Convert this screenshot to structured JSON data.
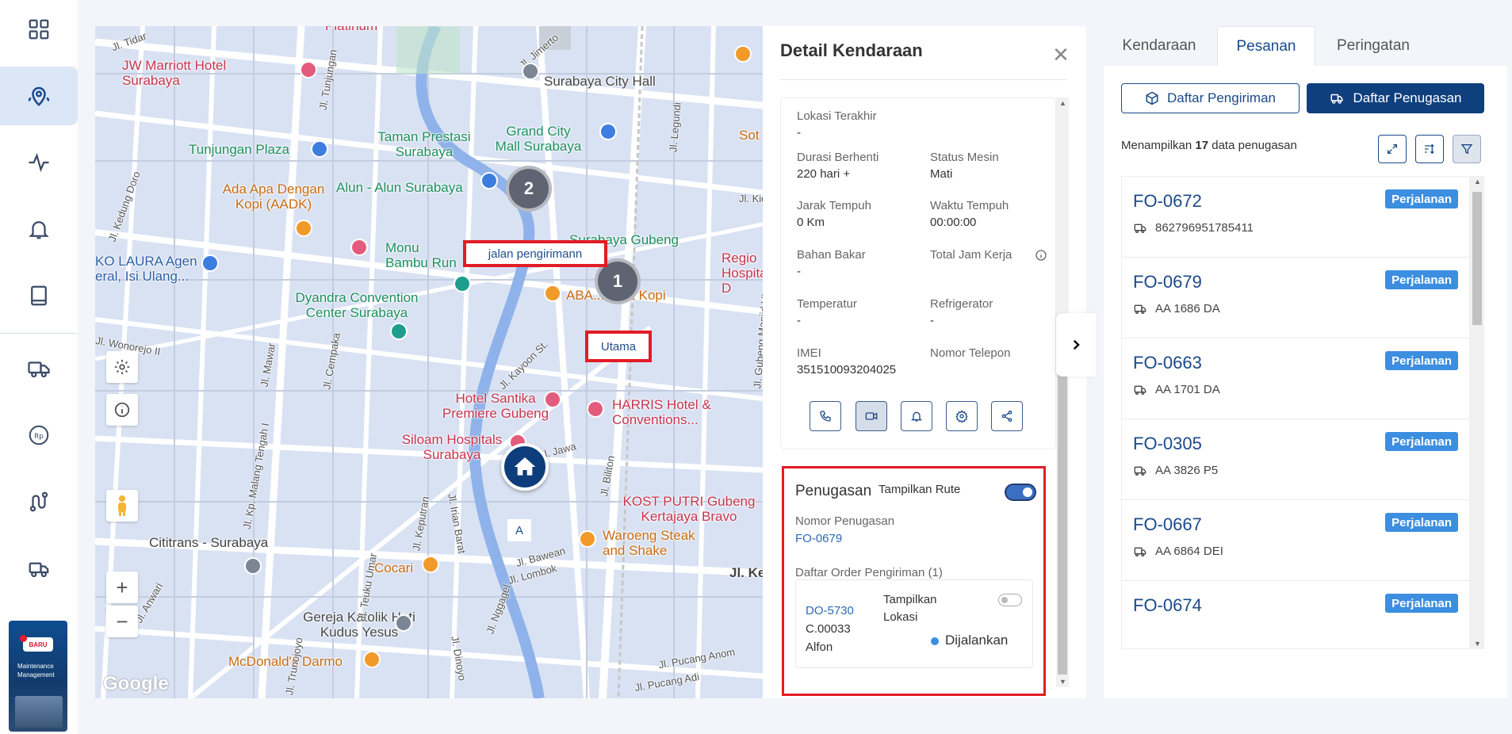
{
  "sidebar": {
    "items": [
      {
        "name": "dashboard",
        "icon": "grid-icon"
      },
      {
        "name": "tracking",
        "icon": "location-pin-icon",
        "active": true
      },
      {
        "name": "activity",
        "icon": "pulse-icon"
      },
      {
        "name": "notifications",
        "icon": "bell-icon"
      },
      {
        "name": "reports",
        "icon": "book-icon"
      },
      {
        "name": "vehicles",
        "icon": "truck-icon"
      },
      {
        "name": "finance",
        "icon": "rupiah-icon"
      },
      {
        "name": "routes",
        "icon": "route-icon"
      },
      {
        "name": "delivery",
        "icon": "delivery-truck-icon"
      }
    ],
    "promo": {
      "badge": "BARU",
      "text": "Maintenance Management"
    }
  },
  "map": {
    "labels": [
      "Platinum",
      "JW Marriott Hotel Surabaya",
      "Jl. Tidar",
      "Jl. Tunjungan",
      "Jl. Jimerto",
      "Surabaya City Hall",
      "Taman Prestasi Surabaya",
      "Grand City Mall Surabaya",
      "Tunjungan Plaza",
      "Alun - Alun Surabaya",
      "Ada Apa Dengan Kopi (AADK)",
      "Monu Bambu Run",
      "Surabaya Gubeng",
      "KO LAURA Agen eral, Isi Ulang...",
      "Dyandra Convention Center Surabaya",
      "ABA... mi & Kopi",
      "Regio Hospital D",
      "Hotel Santika Premiere Gubeng",
      "HARRIS Hotel & Conventions...",
      "Siloam Hospitals Surabaya",
      "Jl. Jawa",
      "Jl. Biliton",
      "KOST PUTRI Gubeng Kertajaya Bravo",
      "Cititrans - Surabaya",
      "Waroeng Steak and Shake",
      "Cocari",
      "Jl. Bawean",
      "Jl. Lombok",
      "Jl. Nggagel",
      "Gereja Katolik Hati Kudus Yesus",
      "McDonald's Darmo",
      "Jl. Kedung Doro",
      "Jl. Pucang Adi",
      "Jl. Pucang Anom",
      "Sot",
      "Jl. Legundi",
      "Jl. Kidal",
      "Jl. Gubeng Masjid VI",
      "Jl. Kayoon St.",
      "Jl. Wonorejo II",
      "Jl. Mawar",
      "Jl. Cempaka",
      "Jl. Kp. Malang Tengah I",
      "Jl. Keputran",
      "Jl. Irian Barat",
      "Jl. Teuku Umar",
      "Jl. Dinoyo",
      "Jl. Anwari",
      "Jl. Trunojoyo",
      "Jl. Ke"
    ],
    "clusters": [
      "2",
      "1"
    ],
    "tags": {
      "route": "jalan pengirimann",
      "main": "Utama",
      "point": "A"
    },
    "zoom_in": "+",
    "zoom_out": "−"
  },
  "detail": {
    "title": "Detail Kendaraan",
    "fields": {
      "lokasi_label": "Lokasi Terakhir",
      "lokasi": "-",
      "durasi_label": "Durasi Berhenti",
      "durasi": "220 hari +",
      "mesin_label": "Status Mesin",
      "mesin": "Mati",
      "jarak_label": "Jarak Tempuh",
      "jarak": "0 Km",
      "waktu_label": "Waktu Tempuh",
      "waktu": "00:00:00",
      "bbm_label": "Bahan Bakar",
      "bbm": "-",
      "jam_label": "Total Jam Kerja",
      "temp_label": "Temperatur",
      "temp": "-",
      "fridge_label": "Refrigerator",
      "fridge": "-",
      "imei_label": "IMEI",
      "imei": "351510093204025",
      "telp_label": "Nomor Telepon"
    },
    "assignment": {
      "title": "Penugasan",
      "route_toggle": "Tampilkan Rute",
      "nomor_label": "Nomor Penugasan",
      "nomor": "FO-0679",
      "orders_label": "Daftar Order Pengiriman (1)",
      "order": {
        "code": "DO-5730",
        "customer_code": "C.00033",
        "customer": "Alfon",
        "location_toggle": "Tampilkan Lokasi",
        "status": "Dijalankan"
      }
    }
  },
  "right": {
    "tabs": [
      "Kendaraan",
      "Pesanan",
      "Peringatan"
    ],
    "btn_pengiriman": "Daftar Pengiriman",
    "btn_penugasan": "Daftar Penugasan",
    "count_prefix": "Menampilkan",
    "count": "17",
    "count_suffix": "data penugasan",
    "rows": [
      {
        "code": "FO-0672",
        "plate": "862796951785411",
        "status": "Perjalanan"
      },
      {
        "code": "FO-0679",
        "plate": "AA 1686 DA",
        "status": "Perjalanan"
      },
      {
        "code": "FO-0663",
        "plate": "AA 1701 DA",
        "status": "Perjalanan"
      },
      {
        "code": "FO-0305",
        "plate": "AA 3826 P5",
        "status": "Perjalanan"
      },
      {
        "code": "FO-0667",
        "plate": "AA 6864 DEI",
        "status": "Perjalanan"
      },
      {
        "code": "FO-0674",
        "plate": "",
        "status": "Perjalanan"
      }
    ]
  },
  "colors": {
    "primary": "#0f3f7d",
    "status": "#3c8ee0",
    "highlight": "#e31c24"
  }
}
